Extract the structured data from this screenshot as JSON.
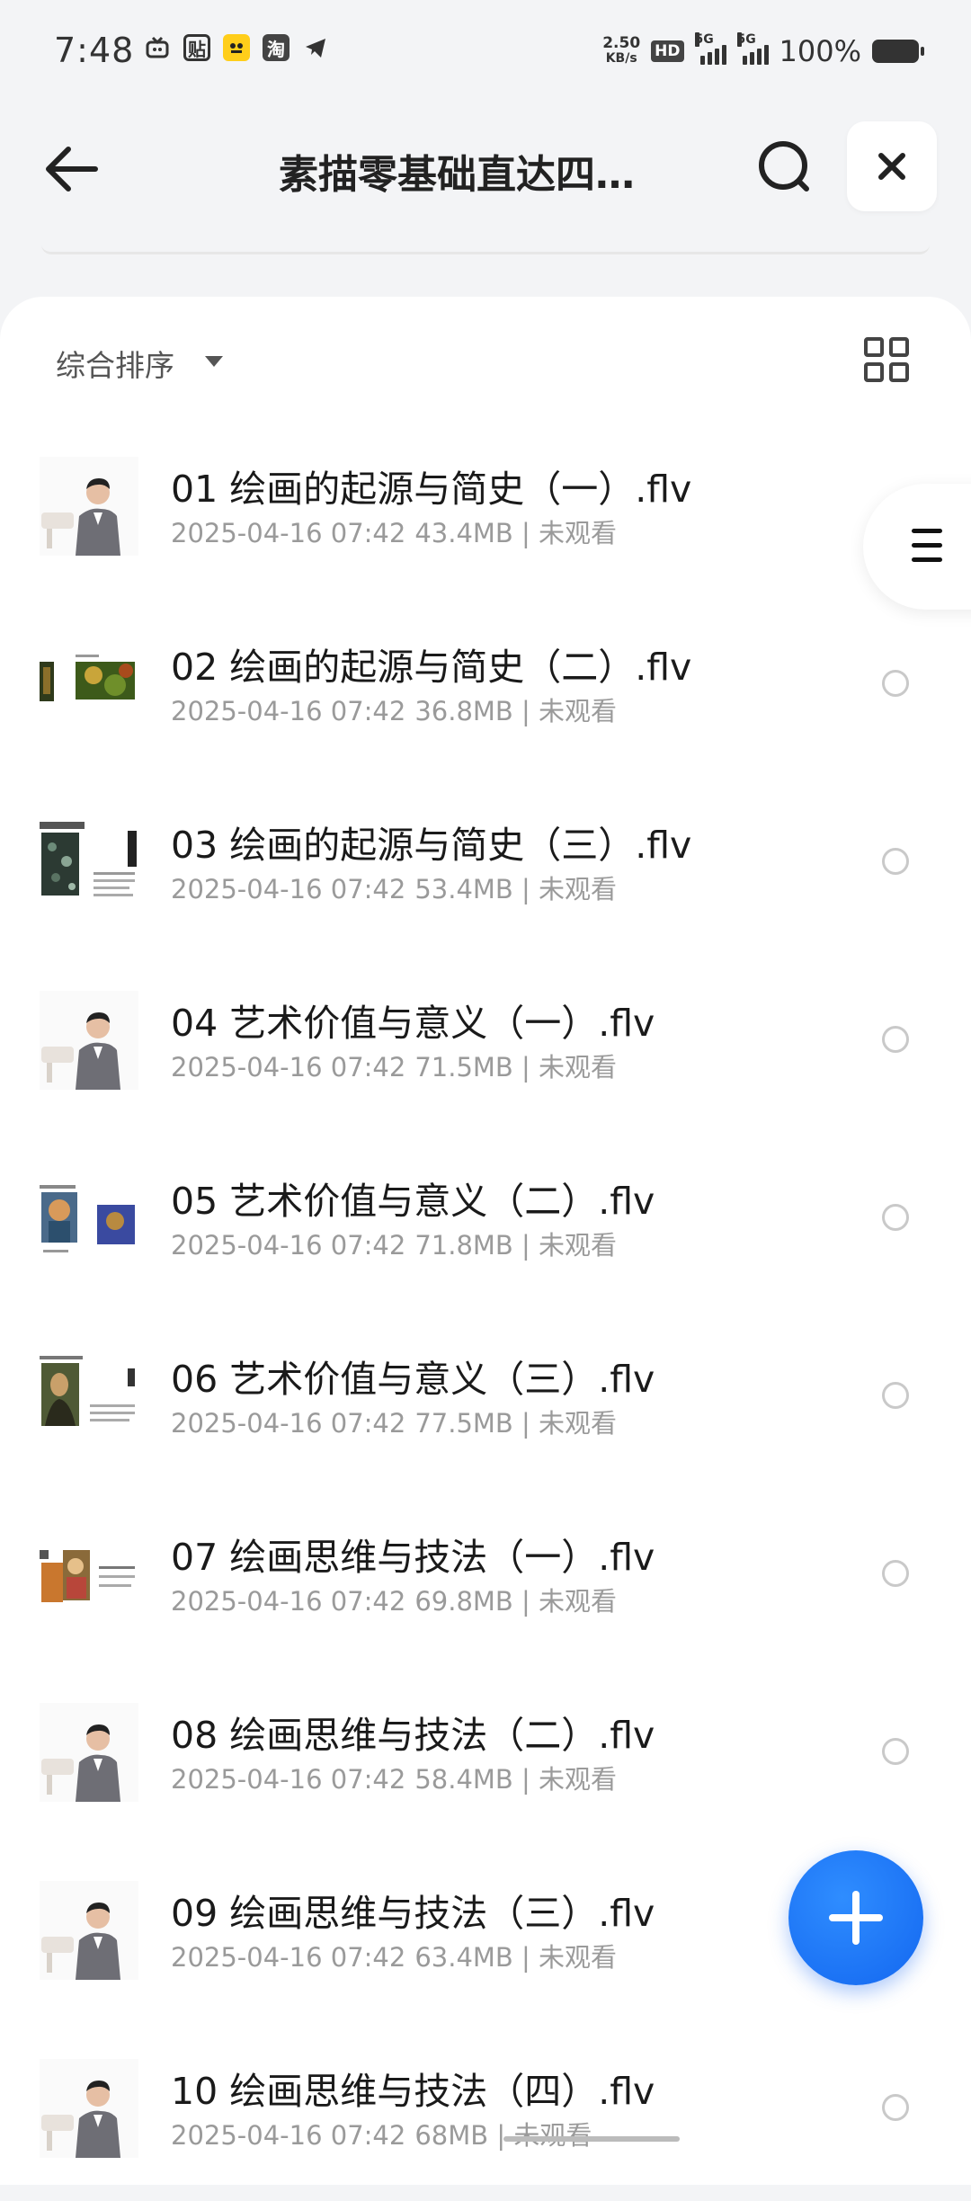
{
  "status_bar": {
    "time": "7:48",
    "net_speed_value": "2.50",
    "net_speed_unit": "KB/s",
    "hd_label": "HD",
    "sim1": "5G",
    "sim2": "5G",
    "battery": "100%",
    "left_icons": [
      "tv-icon",
      "tie-icon",
      "game-icon",
      "taobao-icon",
      "telegram-icon"
    ],
    "tie_label": "贴",
    "taobao_label": "淘"
  },
  "header": {
    "title": "素描零基础直达四…"
  },
  "toolbar": {
    "sort_label": "综合排序"
  },
  "files": [
    {
      "title": "01 绘画的起源与简史（一）.flv",
      "date": "2025-04-16 07:42",
      "size": "43.4MB",
      "status": "未观看",
      "thumb": "person"
    },
    {
      "title": "02 绘画的起源与简史（二）.flv",
      "date": "2025-04-16 07:42",
      "size": "36.8MB",
      "status": "未观看",
      "thumb": "painting-green"
    },
    {
      "title": "03 绘画的起源与简史（三）.flv",
      "date": "2025-04-16 07:42",
      "size": "53.4MB",
      "status": "未观看",
      "thumb": "painting-dark"
    },
    {
      "title": "04 艺术价值与意义（一）.flv",
      "date": "2025-04-16 07:42",
      "size": "71.5MB",
      "status": "未观看",
      "thumb": "person"
    },
    {
      "title": "05 艺术价值与意义（二）.flv",
      "date": "2025-04-16 07:42",
      "size": "71.8MB",
      "status": "未观看",
      "thumb": "painting-portrait"
    },
    {
      "title": "06 艺术价值与意义（三）.flv",
      "date": "2025-04-16 07:42",
      "size": "77.5MB",
      "status": "未观看",
      "thumb": "painting-mona"
    },
    {
      "title": "07 绘画思维与技法（一）.flv",
      "date": "2025-04-16 07:42",
      "size": "69.8MB",
      "status": "未观看",
      "thumb": "painting-warm"
    },
    {
      "title": "08 绘画思维与技法（二）.flv",
      "date": "2025-04-16 07:42",
      "size": "58.4MB",
      "status": "未观看",
      "thumb": "person"
    },
    {
      "title": "09 绘画思维与技法（三）.flv",
      "date": "2025-04-16 07:42",
      "size": "63.4MB",
      "status": "未观看",
      "thumb": "person"
    },
    {
      "title": "10 绘画思维与技法（四）.flv",
      "date": "2025-04-16 07:42",
      "size": "68MB",
      "status": "未观看",
      "thumb": "person"
    }
  ],
  "colors": {
    "accent": "#1a6ef5",
    "background": "#f3f4f6",
    "meta_text": "#9a9a9a"
  }
}
